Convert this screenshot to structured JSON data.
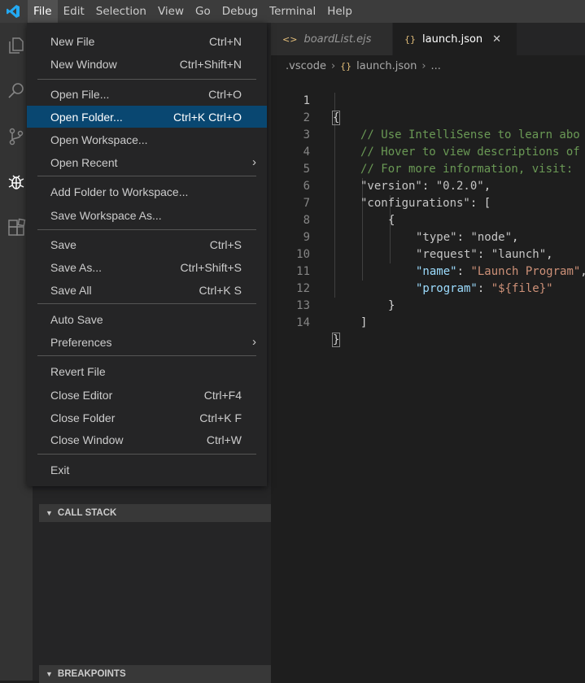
{
  "menubar": [
    "File",
    "Edit",
    "Selection",
    "View",
    "Go",
    "Debug",
    "Terminal",
    "Help"
  ],
  "file_menu": {
    "new_file": {
      "label": "New File",
      "shortcut": "Ctrl+N"
    },
    "new_window": {
      "label": "New Window",
      "shortcut": "Ctrl+Shift+N"
    },
    "open_file": {
      "label": "Open File...",
      "shortcut": "Ctrl+O"
    },
    "open_folder": {
      "label": "Open Folder...",
      "shortcut": "Ctrl+K Ctrl+O"
    },
    "open_workspace": {
      "label": "Open Workspace..."
    },
    "open_recent": {
      "label": "Open Recent"
    },
    "add_folder": {
      "label": "Add Folder to Workspace..."
    },
    "save_workspace_as": {
      "label": "Save Workspace As..."
    },
    "save": {
      "label": "Save",
      "shortcut": "Ctrl+S"
    },
    "save_as": {
      "label": "Save As...",
      "shortcut": "Ctrl+Shift+S"
    },
    "save_all": {
      "label": "Save All",
      "shortcut": "Ctrl+K S"
    },
    "auto_save": {
      "label": "Auto Save"
    },
    "preferences": {
      "label": "Preferences"
    },
    "revert_file": {
      "label": "Revert File"
    },
    "close_editor": {
      "label": "Close Editor",
      "shortcut": "Ctrl+F4"
    },
    "close_folder": {
      "label": "Close Folder",
      "shortcut": "Ctrl+K F"
    },
    "close_window": {
      "label": "Close Window",
      "shortcut": "Ctrl+W"
    },
    "exit": {
      "label": "Exit"
    }
  },
  "sidebar": {
    "call_stack": "CALL STACK",
    "breakpoints": "BREAKPOINTS"
  },
  "tabs": [
    {
      "label": "boardList.ejs",
      "icon": "<>"
    },
    {
      "label": "launch.json",
      "icon": "{}"
    }
  ],
  "breadcrumb": {
    "folder": ".vscode",
    "file": "launch.json",
    "more": "..."
  },
  "code": {
    "line_numbers": [
      "1",
      "2",
      "3",
      "4",
      "5",
      "6",
      "7",
      "8",
      "9",
      "10",
      "11",
      "12",
      "13",
      "14"
    ],
    "l1": "{",
    "l2": "// Use IntelliSense to learn abo",
    "l3": "// Hover to view descriptions of",
    "l4": "// For more information, visit: ",
    "l5_key": "\"version\"",
    "l5_val": "\"0.2.0\"",
    "l6_key": "\"configurations\"",
    "l7": "{",
    "l8_key": "\"type\"",
    "l8_val": "\"node\"",
    "l9_key": "\"request\"",
    "l9_val": "\"launch\"",
    "l10_key": "\"name\"",
    "l10_val": "\"Launch Program\"",
    "l11_key": "\"program\"",
    "l11_val": "\"${file}\"",
    "l12": "}",
    "l13": "]",
    "l14": "}"
  },
  "colors": {
    "accent": "#094771",
    "logo": "#23a9f2",
    "comment": "#6a9955",
    "string": "#ce9178",
    "key": "#9cdcfe"
  }
}
